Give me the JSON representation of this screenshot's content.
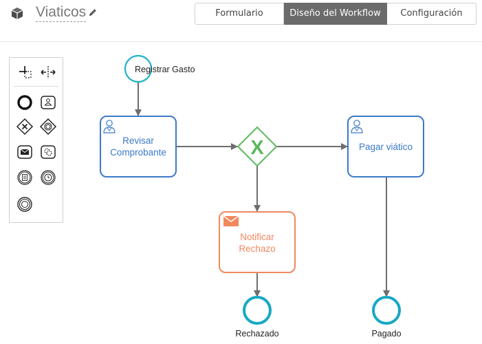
{
  "header": {
    "app_title": "Viaticos",
    "icons": {
      "app": "box-icon",
      "edit": "pencil-icon"
    },
    "tabs": [
      {
        "label": "Formulario",
        "active": false
      },
      {
        "label": "Diseño del Workflow",
        "active": true
      },
      {
        "label": "Configuración",
        "active": false
      }
    ]
  },
  "palette": {
    "tools": [
      "lasso-tool-icon",
      "space-tool-icon",
      "end-event-icon",
      "user-task-icon",
      "exclusive-gateway-icon",
      "event-gateway-icon",
      "message-task-icon",
      "service-task-icon",
      "conditional-event-icon",
      "timer-event-icon",
      "intermediate-event-icon"
    ]
  },
  "diagram": {
    "start_event": "Registrar Gasto",
    "tasks": {
      "revisar": [
        "Revisar",
        "Comprobante"
      ],
      "pagar": [
        "Pagar viático"
      ],
      "notificar": [
        "Notificar",
        "Rechazo"
      ]
    },
    "gateway_symbol": "X",
    "end_events": {
      "rechazado": "Rechazado",
      "pagado": "Pagado"
    }
  },
  "colors": {
    "task_blue": "#3b79c9",
    "start_teal": "#22b2c6",
    "end_teal": "#16a8c4",
    "gateway_green": "#5cb85c",
    "message_orange": "#f1885e",
    "flow_gray": "#6d6d6d",
    "active_tab": "#6b6b6b"
  }
}
